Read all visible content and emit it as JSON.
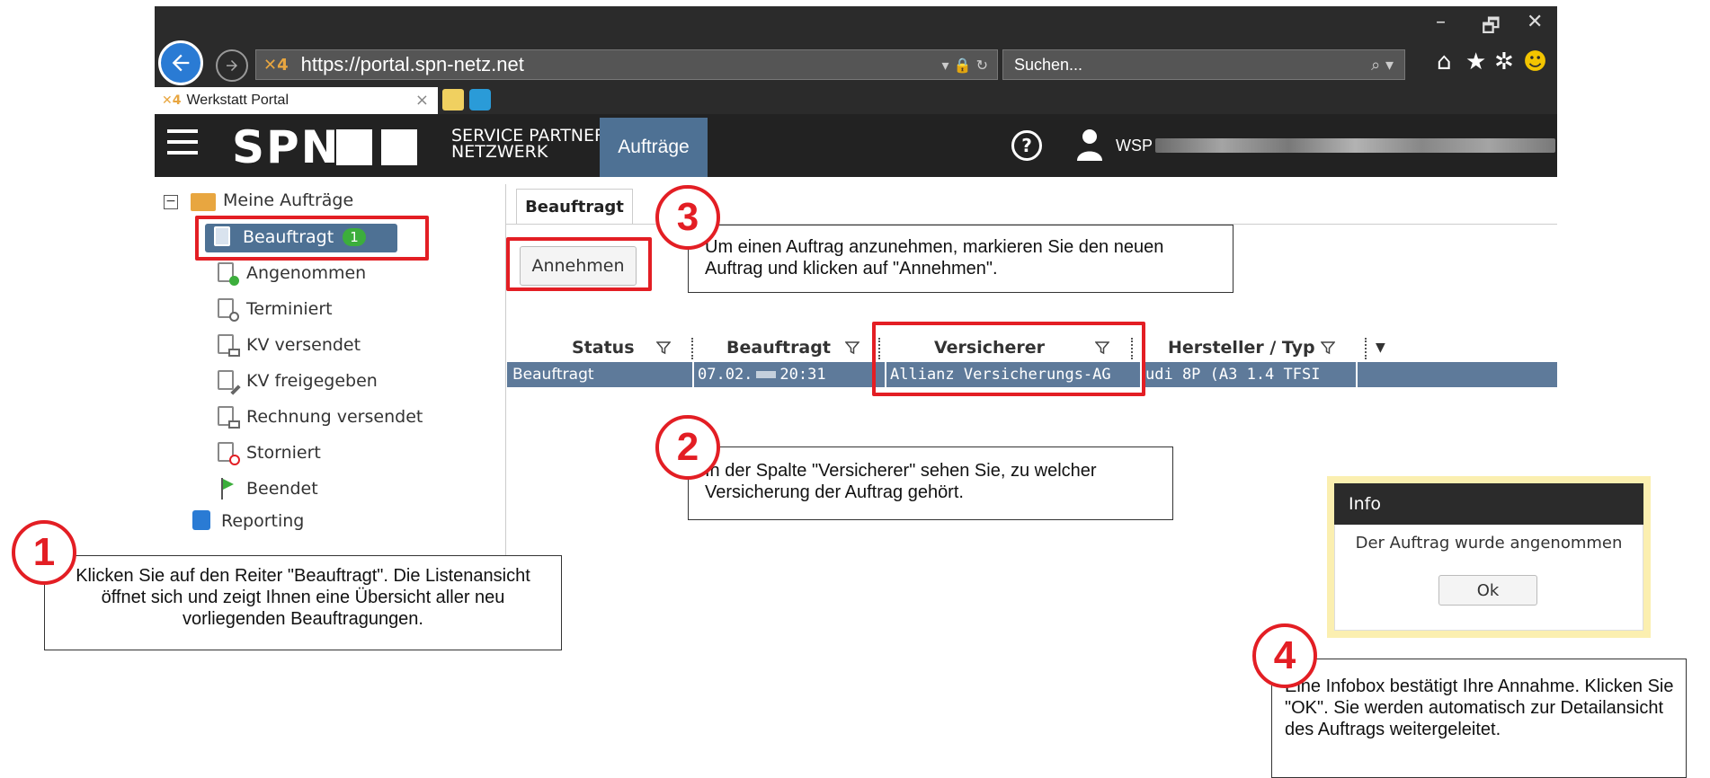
{
  "browser": {
    "url": "https://portal.spn-netz.net",
    "search_placeholder": "Suchen...",
    "tab_title": "Werkstatt Portal",
    "minimize": "–",
    "restore": "🗗",
    "close": "✕"
  },
  "header": {
    "logo": "SPN",
    "logo_sub_line1": "SERVICE PARTNER",
    "logo_sub_line2": "NETZWERK",
    "nav_auftraege": "Aufträge",
    "help": "?",
    "user": "WSP"
  },
  "sidebar": {
    "root_label": "Meine Aufträge",
    "items": [
      {
        "label": "Beauftragt",
        "badge": "1"
      },
      {
        "label": "Angenommen"
      },
      {
        "label": "Terminiert"
      },
      {
        "label": "KV versendet"
      },
      {
        "label": "KV freigegeben"
      },
      {
        "label": "Rechnung versendet"
      },
      {
        "label": "Storniert"
      },
      {
        "label": "Beendet"
      }
    ],
    "reporting": "Reporting"
  },
  "content": {
    "tab": "Beauftragt",
    "accept_button": "Annehmen",
    "columns": [
      "Status",
      "Beauftragt",
      "Versicherer",
      "Hersteller / Typ"
    ],
    "row": {
      "status": "Beauftragt",
      "date_prefix": "07.02.",
      "time": "20:31",
      "insurer": "Allianz Versicherungs-AG",
      "make": "udi 8P (A3 1.4 TFSI"
    }
  },
  "dialog": {
    "title": "Info",
    "message": "Der Auftrag wurde angenommen",
    "ok": "Ok"
  },
  "annotations": {
    "step1_num": "1",
    "step1_text": "Klicken Sie auf den Reiter \"Beauftragt\". Die Listenansicht öffnet sich und zeigt  Ihnen eine Übersicht aller neu vorliegenden Beauftragungen.",
    "step2_num": "2",
    "step2_text": "In der Spalte \"Versicherer\" sehen Sie, zu welcher Versicherung der Auftrag gehört.",
    "step3_num": "3",
    "step3_text": "Um einen Auftrag anzunehmen, markieren Sie den neuen Auftrag und klicken auf \"Annehmen\".",
    "step4_num": "4",
    "step4_text": "Eine Infobox bestätigt Ihre Annahme. Klicken Sie \"OK\". Sie werden automatisch zur Detailansicht des Auftrags weitergeleitet."
  }
}
